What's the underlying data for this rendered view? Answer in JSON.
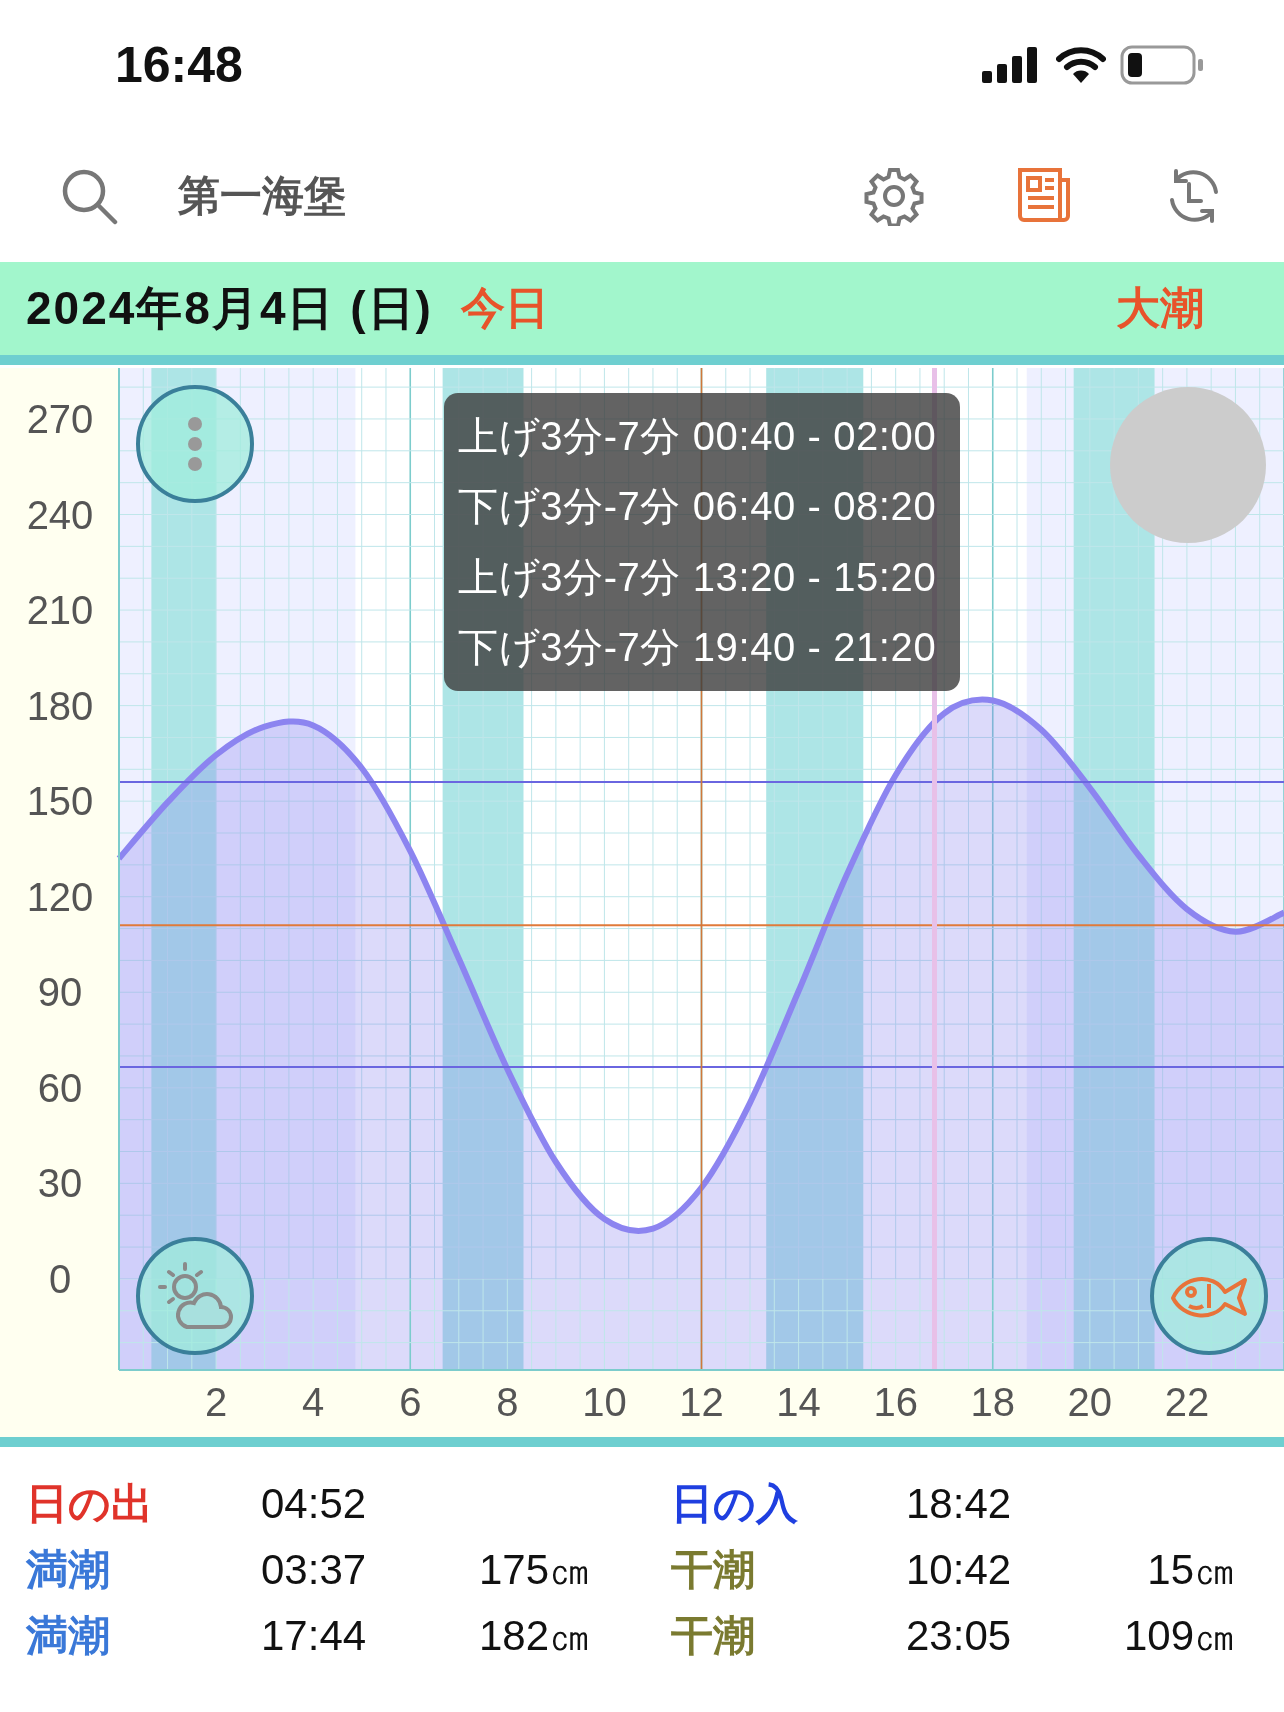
{
  "status_bar": {
    "time": "16:48"
  },
  "header": {
    "location": "第一海堡",
    "tools": [
      {
        "kind": "settings",
        "active": false
      },
      {
        "kind": "news",
        "active": true
      },
      {
        "kind": "history",
        "active": false
      }
    ]
  },
  "date_bar": {
    "date": "2024年8月4日 (日)",
    "today": "今日",
    "tide_type": "大潮"
  },
  "chart": {
    "tooltip": [
      "上げ3分-7分 00:40 - 02:00",
      "下げ3分-7分 06:40 - 08:20",
      "上げ3分-7分 13:20 - 15:20",
      "下げ3分-7分 19:40 - 21:20"
    ],
    "chart_data": {
      "type": "area",
      "xlim": [
        0,
        24
      ],
      "ylim": [
        -28.6,
        286
      ],
      "xticks": [
        2,
        4,
        6,
        8,
        10,
        12,
        14,
        16,
        18,
        20,
        22
      ],
      "yticks": [
        0,
        30,
        60,
        90,
        120,
        150,
        180,
        210,
        240,
        270
      ],
      "x": [
        0,
        1,
        2,
        3,
        4,
        5,
        6,
        7,
        8,
        9,
        10,
        11,
        12,
        13,
        14,
        15,
        16,
        17,
        18,
        19,
        20,
        21,
        22,
        23,
        24
      ],
      "grid": true,
      "series": [
        {
          "color": "#8c84f0",
          "values": [
            132,
            149.6,
            164.5,
            173.4,
            173.8,
            160.4,
            134.3,
            100.6,
            65.9,
            36.7,
            18.8,
            15.8,
            28.7,
            55.3,
            90.4,
            127.1,
            158.2,
            177.6,
            181.6,
            172.4,
            154.2,
            133.1,
            116.1,
            109,
            115
          ]
        }
      ],
      "bands": [
        {
          "axis": "x",
          "from": 0,
          "to": 4.87,
          "color": "#eef0ff"
        },
        {
          "axis": "x",
          "from": 18.7,
          "to": 24,
          "color": "#eef0ff"
        },
        {
          "axis": "x",
          "from": 0.667,
          "to": 2,
          "color": "#ade5e6"
        },
        {
          "axis": "x",
          "from": 6.667,
          "to": 8.333,
          "color": "#ade5e6"
        },
        {
          "axis": "x",
          "from": 13.333,
          "to": 15.333,
          "color": "#ade5e6"
        },
        {
          "axis": "x",
          "from": 19.667,
          "to": 21.333,
          "color": "#ade5e6"
        },
        {
          "axis": "y",
          "from": -28.6,
          "to": 0,
          "color": "#8c84f0"
        }
      ],
      "ref_lines": [
        {
          "axis": "y",
          "value": 156,
          "color": "#6a66e0"
        },
        {
          "axis": "y",
          "value": 111,
          "color": "#e07a3a"
        },
        {
          "axis": "y",
          "value": 66.5,
          "color": "#6a66e0"
        },
        {
          "axis": "x",
          "value": 12,
          "color": "#d0783a"
        },
        {
          "axis": "x",
          "value": 16.8,
          "color": "#e8c0e8"
        }
      ]
    }
  },
  "tide_table": {
    "rows": [
      {
        "cells": [
          {
            "kind": "sunrise",
            "label": "日の出",
            "time": "04:52"
          },
          {
            "kind": "sunset",
            "label": "日の入",
            "time": "18:42"
          }
        ]
      },
      {
        "cells": [
          {
            "kind": "high",
            "label": "満潮",
            "time": "03:37",
            "height": "175㎝"
          },
          {
            "kind": "low",
            "label": "干潮",
            "time": "10:42",
            "height": "15㎝"
          }
        ]
      },
      {
        "cells": [
          {
            "kind": "high",
            "label": "満潮",
            "time": "17:44",
            "height": "182㎝"
          },
          {
            "kind": "low",
            "label": "干潮",
            "time": "23:05",
            "height": "109㎝"
          }
        ]
      }
    ]
  }
}
